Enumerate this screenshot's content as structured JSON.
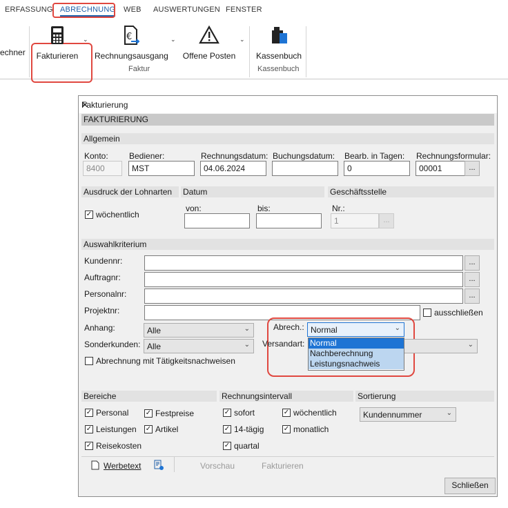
{
  "ribbon": {
    "tabs": [
      "ERFASSUNG",
      "ABRECHNUNG",
      "WEB",
      "AUSWERTUNGEN",
      "FENSTER"
    ],
    "left_cut_label": "echner",
    "buttons": {
      "fakturieren": "Fakturieren",
      "rechnungsausgang": "Rechnungsausgang",
      "offene_posten": "Offene Posten",
      "kassenbuch": "Kassenbuch"
    },
    "groups": {
      "faktur": "Faktur",
      "kassenbuch": "Kassenbuch"
    }
  },
  "dialog": {
    "window_title": "Fakturierung",
    "header": "FAKTURIERUNG",
    "allgemein": {
      "section": "Allgemein",
      "konto_label": "Konto:",
      "konto_value": "8400",
      "bediener_label": "Bediener:",
      "bediener_value": "MST",
      "rechnungsdatum_label": "Rechnungsdatum:",
      "rechnungsdatum_value": "04.06.2024",
      "buchungsdatum_label": "Buchungsdatum:",
      "buchungsdatum_value": "",
      "bearb_label": "Bearb. in Tagen:",
      "bearb_value": "0",
      "formular_label": "Rechnungsformular:",
      "formular_value": "00001",
      "ellipsis": "..."
    },
    "ausdruck": {
      "section": "Ausdruck der Lohnarten",
      "woechentlich": "wöchentlich",
      "woechentlich_checked": true
    },
    "datum": {
      "section": "Datum",
      "von_label": "von:",
      "bis_label": "bis:",
      "von_value": "",
      "bis_value": ""
    },
    "geschaeftsstelle": {
      "section": "Geschäftsstelle",
      "nr_label": "Nr.:",
      "nr_value": "1"
    },
    "auswahl": {
      "section": "Auswahlkriterium",
      "kundennr": "Kundennr:",
      "auftragnr": "Auftragnr:",
      "personalnr": "Personalnr:",
      "projektnr": "Projektnr:",
      "ausschliessen": "ausschließen",
      "anhang_label": "Anhang:",
      "anhang_value": "Alle",
      "sonderkunden_label": "Sonderkunden:",
      "sonderkunden_value": "Alle",
      "abrech_label": "Abrech.:",
      "abrech_value": "Normal",
      "abrech_options": [
        "Normal",
        "Nachberechnung",
        "Leistungsnachweis"
      ],
      "versandart_label": "Versandart:",
      "taetigkeit": "Abrechnung mit Tätigkeitsnachweisen"
    },
    "bereiche": {
      "section": "Bereiche",
      "items": [
        {
          "label": "Personal",
          "checked": true
        },
        {
          "label": "Festpreise",
          "checked": true
        },
        {
          "label": "Leistungen",
          "checked": true
        },
        {
          "label": "Artikel",
          "checked": true
        },
        {
          "label": "Reisekosten",
          "checked": true
        }
      ]
    },
    "intervall": {
      "section": "Rechnungsintervall",
      "items": [
        {
          "label": "sofort",
          "checked": true
        },
        {
          "label": "wöchentlich",
          "checked": true
        },
        {
          "label": "14-tägig",
          "checked": true
        },
        {
          "label": "monatlich",
          "checked": true
        },
        {
          "label": "quartal",
          "checked": true
        }
      ]
    },
    "sortierung": {
      "section": "Sortierung",
      "value": "Kundennummer"
    },
    "toolbar": {
      "werbetext": "Werbetext",
      "vorschau": "Vorschau",
      "fakturieren": "Fakturieren"
    },
    "schliessen": "Schließen"
  }
}
